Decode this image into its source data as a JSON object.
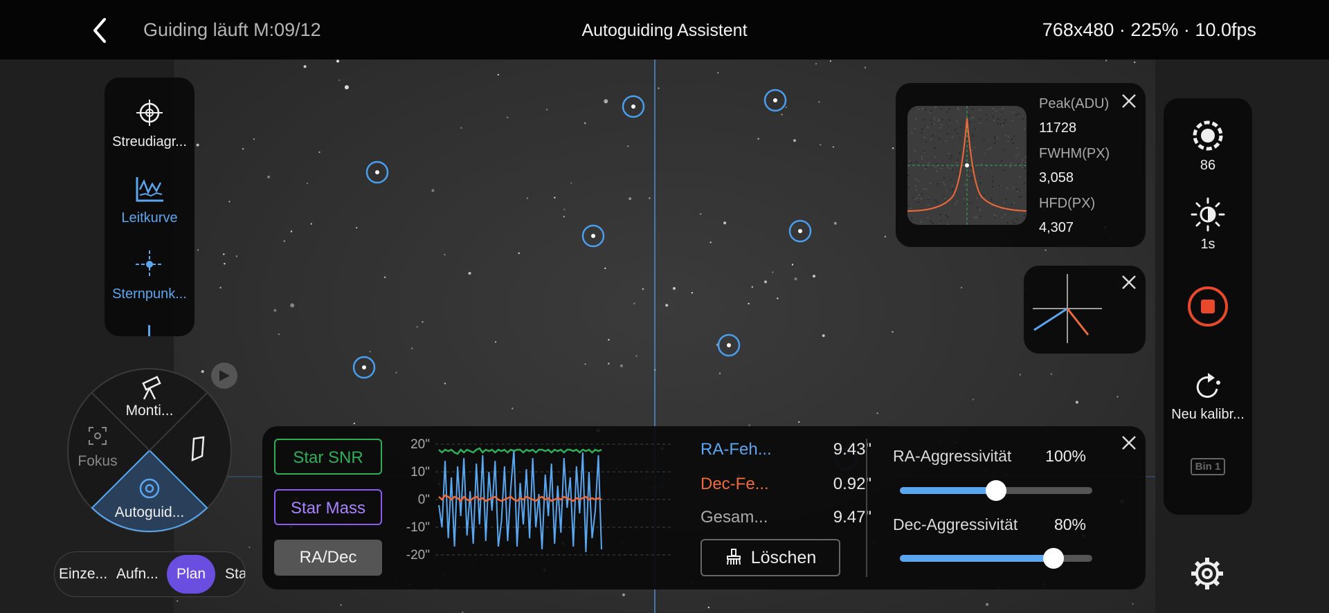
{
  "header": {
    "status": "Guiding läuft M:09/12",
    "title": "Autoguiding Assistent",
    "info": "768x480 · 225% · 10.0fps"
  },
  "toolbox": {
    "items": [
      {
        "label": "Streudiagr...",
        "icon": "crosshair-icon",
        "active": false
      },
      {
        "label": "Leitkurve",
        "icon": "graph-icon",
        "active": true
      },
      {
        "label": "Sternpunk...",
        "icon": "star-point-icon",
        "active": true
      }
    ]
  },
  "wheel": {
    "mount_label": "Monti...",
    "focus_label": "Fokus",
    "autoguide_label": "Autoguid..."
  },
  "modes": {
    "items": [
      "Einze...",
      "Aufn...",
      "Plan",
      "Sta"
    ],
    "active": "Plan"
  },
  "star_panel": {
    "peak_label": "Peak(ADU)",
    "peak_value": "11728",
    "fwhm_label": "FWHM(PX)",
    "fwhm_value": "3,058",
    "hfd_label": "HFD(PX)",
    "hfd_value": "4,307"
  },
  "right_bar": {
    "gain_value": "86",
    "exposure_value": "1s",
    "recalibrate_label": "Neu kalibr...",
    "bin_label": "Bin 1"
  },
  "guide_panel": {
    "buttons": {
      "snr": "Star SNR",
      "mass": "Star Mass",
      "radec": "RA/Dec"
    },
    "ra_label": "RA-Feh...",
    "ra_value": "9.43\"",
    "dec_label": "Dec-Fe...",
    "dec_value": "0.92\"",
    "total_label": "Gesam...",
    "total_value": "9.47\"",
    "clear_label": "Löschen",
    "ra_agg_label": "RA-Aggressivität",
    "ra_agg_value": "100%",
    "ra_agg_level": 0.5,
    "dec_agg_label": "Dec-Aggressivität",
    "dec_agg_value": "80%",
    "dec_agg_level": 0.8
  },
  "chart_data": {
    "type": "line",
    "y_ticks": [
      "20\"",
      "10\"",
      "0\"",
      "-10\"",
      "-20\""
    ],
    "ylim": [
      -20,
      20
    ],
    "series": [
      {
        "color": "#5aa7f0",
        "values": [
          -2,
          -10,
          14,
          -14,
          8,
          -17,
          12,
          -6,
          15,
          -13,
          3,
          -16,
          13,
          -9,
          16,
          -15,
          10,
          -4,
          14,
          -17,
          -8,
          12,
          -15,
          4,
          18,
          -17,
          6,
          -9,
          11,
          -14,
          15,
          -10,
          2,
          -18,
          9,
          -6,
          13,
          -16,
          5,
          -12,
          15,
          -3,
          8,
          -17,
          12,
          -5,
          17,
          -19,
          10,
          -14,
          -4,
          16,
          -18
        ]
      },
      {
        "color": "#f06a3a",
        "values": [
          1,
          0,
          1.5,
          1,
          0,
          1,
          0.5,
          -0.5,
          1,
          0,
          -0.5,
          0.5,
          1,
          0,
          0.5,
          -0.5,
          0,
          0.5,
          1,
          0,
          -0.5,
          0,
          0.5,
          1,
          0,
          -0.5,
          0.5,
          0,
          1,
          0.5,
          0,
          -0.5,
          0.5,
          1,
          0,
          0.5,
          -0.5,
          0,
          0.5,
          0,
          1,
          0.5,
          0,
          -0.5,
          0.5,
          0,
          0.5,
          1,
          0,
          0.5,
          0,
          0.5,
          0
        ]
      },
      {
        "color": "#2fae5a",
        "values": [
          18,
          17,
          18,
          17.5,
          18,
          17,
          16.5,
          18,
          17,
          18,
          17.5,
          17,
          18,
          18.5,
          17,
          18,
          17.5,
          18,
          17,
          18,
          17.5,
          18,
          17,
          18,
          17.5,
          18,
          18,
          17,
          18,
          17.5,
          18,
          17,
          18,
          18,
          17.5,
          18,
          17,
          18,
          17.5,
          18,
          17,
          18,
          18,
          17.5,
          18,
          17,
          18,
          17.5,
          18,
          17,
          18,
          17.5,
          18
        ]
      }
    ]
  },
  "colors": {
    "accent": "#5aa7f0",
    "ra": "#5aa7f0",
    "dec": "#f06a3a",
    "snr": "#2fae5a",
    "mass": "#8a5df0",
    "record": "#e8492a",
    "active_mode": "#6a4ee0"
  }
}
